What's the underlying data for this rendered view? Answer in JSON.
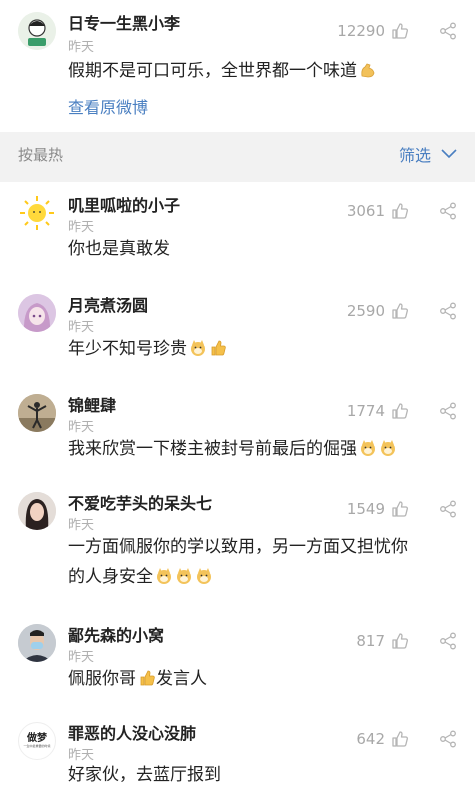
{
  "post": {
    "author": "日专一生黑小李",
    "time": "昨天",
    "likes": "12290",
    "text": "假期不是可口可乐，全世界都一个味道",
    "view_original": "查看原微博"
  },
  "sort_bar": {
    "label": "按最热",
    "filter_label": "筛选"
  },
  "comments": [
    {
      "name": "叽里呱啦的小子",
      "time": "昨天",
      "likes": "3061",
      "text": "你也是真敢发"
    },
    {
      "name": "月亮煮汤圆",
      "time": "昨天",
      "likes": "2590",
      "text": "年少不知号珍贵"
    },
    {
      "name": "锦鲤肆",
      "time": "昨天",
      "likes": "1774",
      "text": "我来欣赏一下楼主被封号前最后的倔强"
    },
    {
      "name": "不爱吃芋头的呆头七",
      "time": "昨天",
      "likes": "1549",
      "text_line1": "一方面佩服你的学以致用，另一方面又担忧你",
      "text_line2": "的人身安全"
    },
    {
      "name": "鄙先森的小窝",
      "time": "昨天",
      "likes": "817",
      "text_a": "佩服你哥",
      "text_b": "发言人"
    },
    {
      "name": "罪恶的人没心没肺",
      "time": "昨天",
      "likes": "642",
      "text": "好家伙，去蓝厅报到",
      "avatar_text": "做梦",
      "avatar_subtext": "一生中最重要的时候"
    }
  ],
  "colors": {
    "link": "#4a7fc1",
    "muted": "#b0b0b0",
    "background": "#f2f2f2"
  },
  "icons": [
    "thumbs-up-icon",
    "share-icon",
    "chevron-down-icon",
    "flexed-biceps-emoji",
    "doge-emoji",
    "thumbs-up-emoji"
  ]
}
